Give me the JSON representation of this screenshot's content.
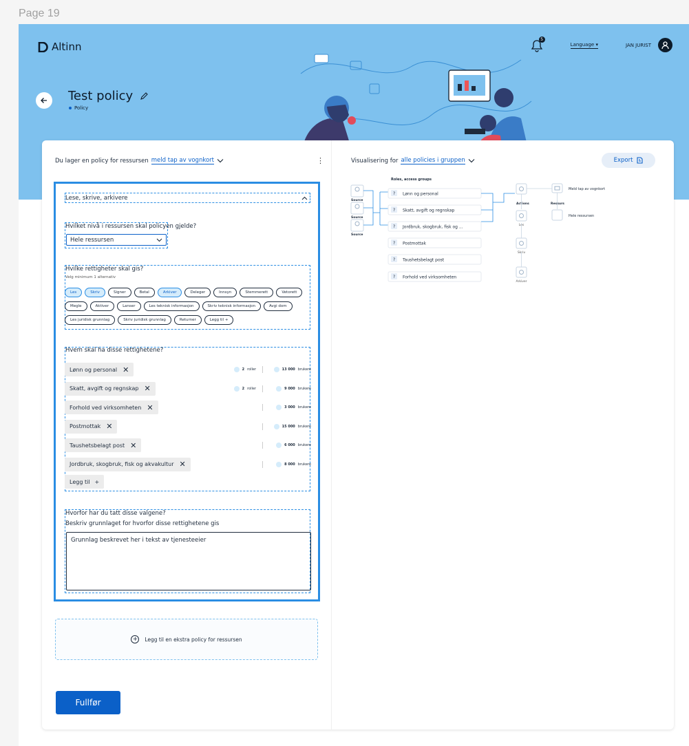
{
  "canvas_label": "Page 19",
  "brand": {
    "name": "Altinn"
  },
  "header": {
    "notification_count": "5",
    "language_label": "Language",
    "user_name": "JAN JURIST"
  },
  "page": {
    "title": "Test policy",
    "subtitle": "Policy"
  },
  "policy": {
    "header_prefix": "Du lager en policy for ressursen",
    "resource_link": "meld tap av vognkort",
    "section_title": "Lese, skrive, arkivere",
    "level_question": "Hvilket nivå i ressursen skal policyen gjelde?",
    "level_value": "Hele ressursen",
    "rights_question": "Hvilke rettigheter skal gis?",
    "rights_hint": "Velg minimum 1 alternativ",
    "rights": [
      {
        "label": "Les",
        "selected": true
      },
      {
        "label": "Skriv",
        "selected": true
      },
      {
        "label": "Signer",
        "selected": false
      },
      {
        "label": "Betal",
        "selected": false
      },
      {
        "label": "Arkiver",
        "selected": true
      },
      {
        "label": "Deleger",
        "selected": false
      },
      {
        "label": "Innsyn",
        "selected": false
      },
      {
        "label": "Stemmerett",
        "selected": false
      },
      {
        "label": "Vetorett",
        "selected": false
      },
      {
        "label": "Megle",
        "selected": false
      },
      {
        "label": "Aktiver",
        "selected": false
      },
      {
        "label": "Lanser",
        "selected": false
      },
      {
        "label": "Les teknisk informasjon",
        "selected": false
      },
      {
        "label": "Skriv teknisk informasjon",
        "selected": false
      },
      {
        "label": "Avgi dom",
        "selected": false
      },
      {
        "label": "Les juridisk grunnlag",
        "selected": false
      },
      {
        "label": "Skriv juridisk grunnlag",
        "selected": false
      },
      {
        "label": "Returner",
        "selected": false
      },
      {
        "label": "Legg til +",
        "selected": false
      }
    ],
    "who_question": "Hvem skal ha disse rettighetene?",
    "groups": [
      {
        "name": "Lønn og personal",
        "roles_count": "2",
        "roles_unit": "roller",
        "users_count": "13 000",
        "users_unit": "brukere"
      },
      {
        "name": "Skatt, avgift og regnskap",
        "roles_count": "2",
        "roles_unit": "roller",
        "users_count": "9 000",
        "users_unit": "brukere"
      },
      {
        "name": "Forhold ved virksomheten",
        "roles_count": "",
        "roles_unit": "",
        "users_count": "3 000",
        "users_unit": "brukere"
      },
      {
        "name": "Postmottak",
        "roles_count": "",
        "roles_unit": "",
        "users_count": "15 000",
        "users_unit": "brukere"
      },
      {
        "name": "Taushetsbelagt post",
        "roles_count": "",
        "roles_unit": "",
        "users_count": "6 000",
        "users_unit": "brukere"
      },
      {
        "name": "Jordbruk, skogbruk, fisk og akvakultur",
        "roles_count": "",
        "roles_unit": "",
        "users_count": "8 000",
        "users_unit": "brukere"
      }
    ],
    "add_label": "Legg til",
    "why_question": "Hvorfor har du tatt disse valgene?",
    "why_hint": "Beskriv grunnlaget for hvorfor disse rettighetene gis",
    "why_text": "Grunnlag beskrevet her i tekst av tjenesteeier",
    "extra_policy_label": "Legg til en ekstra policy for ressursen",
    "finish_label": "Fullfør"
  },
  "visual": {
    "header_prefix": "Visualisering for",
    "header_link": "alle policies i gruppen",
    "export_label": "Export",
    "roles_title": "Roles, access groups",
    "source_label": "Source",
    "groups": [
      "Lønn og personal",
      "Skatt, avgift og regnskap",
      "Jordbruk, skogbruk, fisk og ...",
      "Postmottak",
      "Taushetsbelagt post",
      "Forhold ved virksomheten"
    ],
    "actions_title": "Actions",
    "actions": [
      "Les",
      "Skriv",
      "Arkiver"
    ],
    "ressurs_title": "Ressurs",
    "resources": [
      "Meld tap av vognkort",
      "Hele ressursen"
    ],
    "question_mark": "?"
  },
  "colors": {
    "hero": "#7ec1ee",
    "primary": "#0b60c8",
    "accent": "#2a8de3",
    "chip_selected": "#d5ecfb"
  }
}
